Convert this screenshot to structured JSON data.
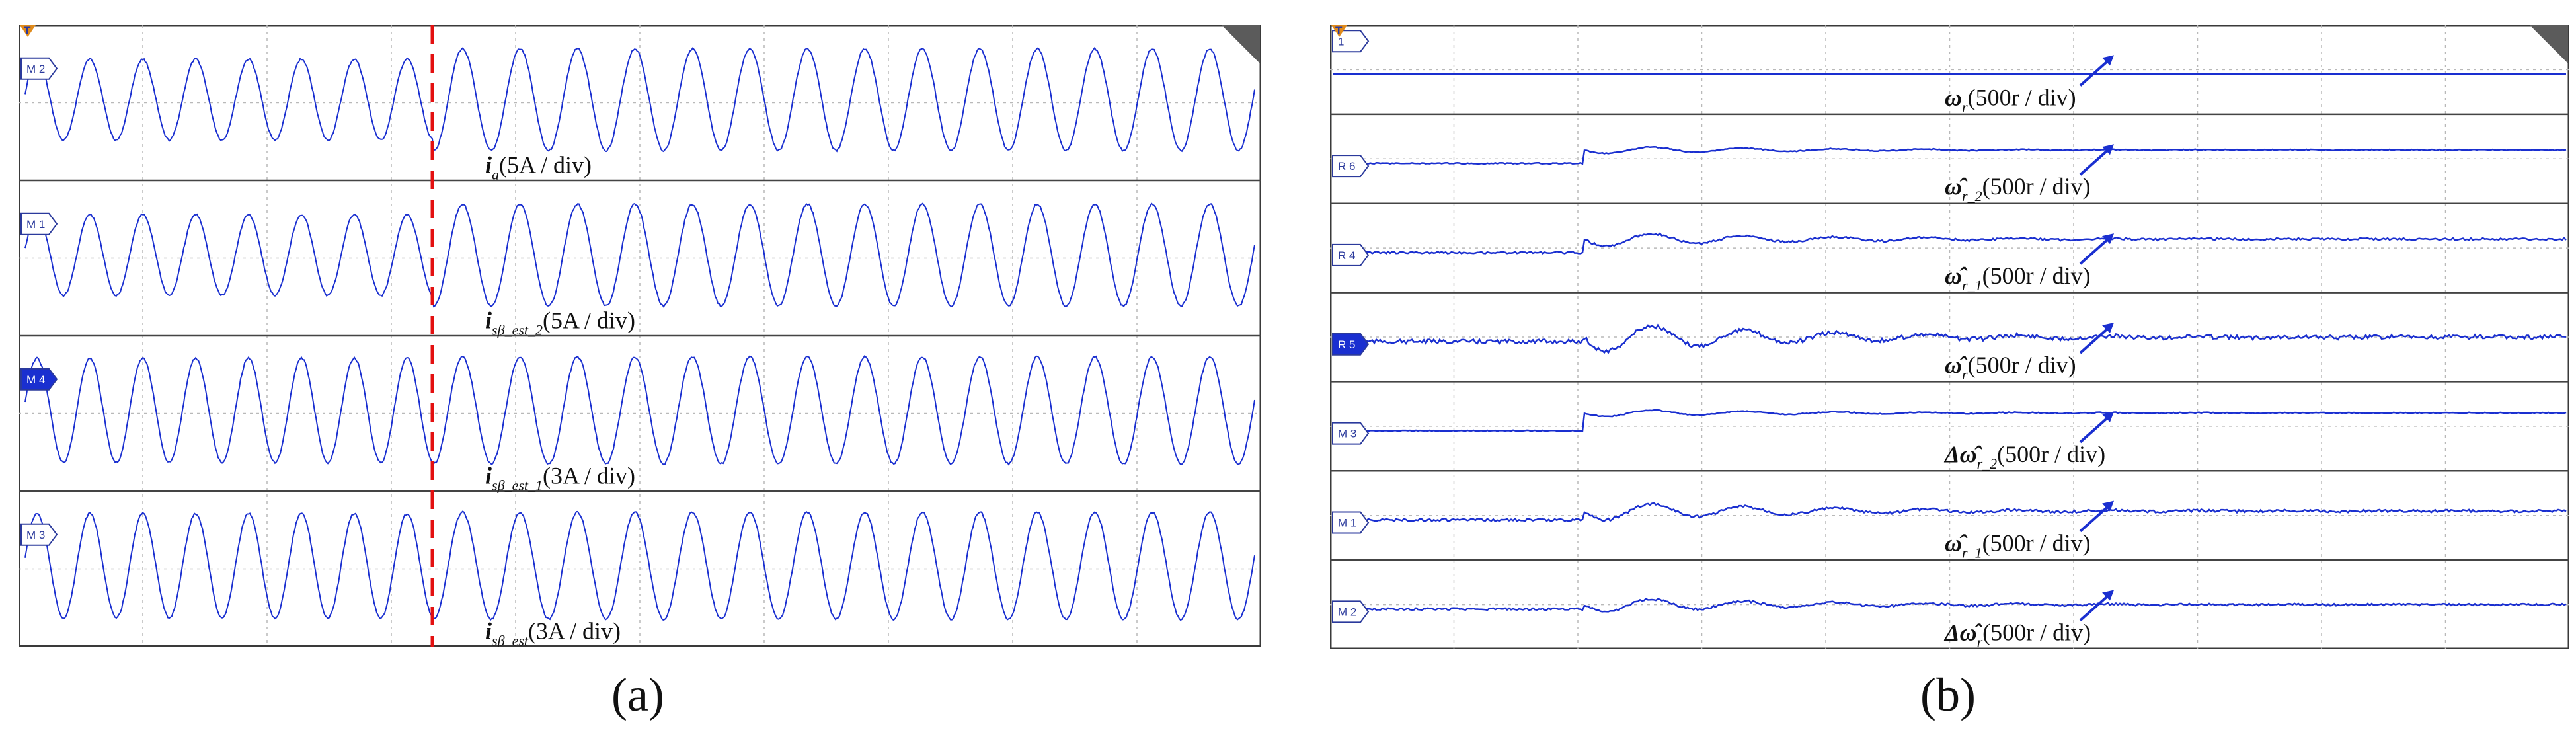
{
  "chart_data": [
    {
      "type": "line",
      "panel_label": "(a)",
      "channels": [
        {
          "marker": "M 2",
          "label": "i",
          "label_sub": "a",
          "scale": "(5A / div)",
          "freq_before": 0.025,
          "freq_after": 0.023,
          "amp_before": 0.62,
          "amp_after": 0.78
        },
        {
          "marker": "M 1",
          "label": "i",
          "label_sub": "sβ_est_2",
          "scale": "(5A / div)",
          "freq_before": 0.025,
          "freq_after": 0.023,
          "amp_before": 0.62,
          "amp_after": 0.78
        },
        {
          "marker": "M 4",
          "label": "i",
          "label_sub": "sβ_est_1",
          "scale": "(3A / div)",
          "freq_before": 0.025,
          "freq_after": 0.023,
          "amp_before": 0.8,
          "amp_after": 0.82
        },
        {
          "marker": "M 3",
          "label": "i",
          "label_sub": "sβ_est",
          "scale": "(3A / div)",
          "freq_before": 0.025,
          "freq_after": 0.023,
          "amp_before": 0.8,
          "amp_after": 0.82
        }
      ],
      "trigger_fraction": 0.333,
      "grid": true
    },
    {
      "type": "line",
      "panel_label": "(b)",
      "channels": [
        {
          "marker": "1",
          "label": "ω",
          "label_sub": "r",
          "scale": "(500r / div)",
          "step": 0.0,
          "ripple": 0.0
        },
        {
          "marker": "R 6",
          "label": "ω̂",
          "label_sub": "r_2",
          "scale": "(500r / div)",
          "step": 0.15,
          "ripple": 0.02
        },
        {
          "marker": "R 4",
          "label": "ω̂",
          "label_sub": "r_1",
          "scale": "(500r / div)",
          "step": 0.15,
          "ripple": 0.04
        },
        {
          "marker": "R 5",
          "label": "ω̂",
          "label_sub": "r",
          "scale": "(500r / div)",
          "step": 0.05,
          "ripple": 0.08
        },
        {
          "marker": "M 3",
          "label": "Δω̂",
          "label_sub": "r_2",
          "scale": "(500r / div)",
          "step": 0.2,
          "ripple": 0.02
        },
        {
          "marker": "M 1",
          "label": "ω̂",
          "label_sub": "r_1",
          "scale": "(500r / div)",
          "step": 0.1,
          "ripple": 0.05
        },
        {
          "marker": "M 2",
          "label": "Δω̂",
          "label_sub": "r",
          "scale": "(500r / div)",
          "step": 0.05,
          "ripple": 0.04
        }
      ],
      "step_fraction": 0.205,
      "grid": true
    }
  ]
}
